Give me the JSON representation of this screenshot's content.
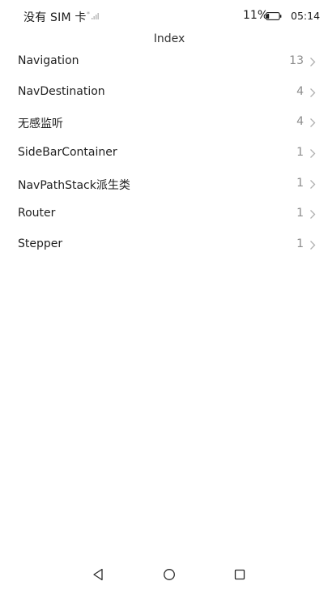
{
  "status_bar": {
    "carrier": "没有 SIM 卡",
    "battery": "11%",
    "time": "05:14"
  },
  "page": {
    "title": "Index"
  },
  "list": {
    "items": [
      {
        "label": "Navigation",
        "count": "13"
      },
      {
        "label": "NavDestination",
        "count": "4"
      },
      {
        "label": "无感监听",
        "count": "4"
      },
      {
        "label": "SideBarContainer",
        "count": "1"
      },
      {
        "label": "NavPathStack派生类",
        "count": "1"
      },
      {
        "label": "Router",
        "count": "1"
      },
      {
        "label": "Stepper",
        "count": "1"
      }
    ]
  },
  "nav_bar": {
    "icons": [
      "back-triangle-icon",
      "home-circle-icon",
      "recent-square-icon"
    ]
  },
  "colors": {
    "background": "#ffffff",
    "text": "#1f1f1f",
    "count": "#8c8c8c",
    "chevron": "#b0b0b0"
  }
}
